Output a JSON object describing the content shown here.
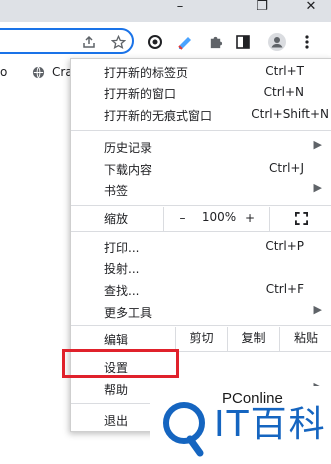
{
  "window": {
    "minimize_glyph": "–",
    "maximize_glyph": "❐",
    "close_glyph": "✕"
  },
  "toolbar": {
    "share_icon": "share-icon",
    "bookmark_icon": "star-icon",
    "extensions": [
      "extension-icon-1",
      "extension-icon-2"
    ],
    "puzzle_icon": "puzzle-icon",
    "sidepanel_icon": "side-panel-icon",
    "profile_icon": "profile-icon",
    "menu_icon": "more-vert-icon"
  },
  "bookmarks": {
    "items": [
      "o",
      "Cra"
    ]
  },
  "menu": {
    "new_tab": {
      "label": "打开新的标签页",
      "shortcut": "Ctrl+T"
    },
    "new_window": {
      "label": "打开新的窗口",
      "shortcut": "Ctrl+N"
    },
    "new_incognito": {
      "label": "打开新的无痕式窗口",
      "shortcut": "Ctrl+Shift+N"
    },
    "history": {
      "label": "历史记录"
    },
    "downloads": {
      "label": "下载内容",
      "shortcut": "Ctrl+J"
    },
    "bookmarks": {
      "label": "书签"
    },
    "zoom": {
      "label": "缩放",
      "minus": "–",
      "value": "100%",
      "plus": "+",
      "fullscreen": "⛶"
    },
    "print": {
      "label": "打印...",
      "shortcut": "Ctrl+P"
    },
    "cast": {
      "label": "投射..."
    },
    "find": {
      "label": "查找...",
      "shortcut": "Ctrl+F"
    },
    "more_tools": {
      "label": "更多工具"
    },
    "edit": {
      "label": "编辑",
      "cut": "剪切",
      "copy": "复制",
      "paste": "粘贴"
    },
    "settings": {
      "label": "设置"
    },
    "help": {
      "label": "帮助"
    },
    "exit": {
      "label": "退出"
    }
  },
  "watermark": {
    "brand": "PConline",
    "text": "IT百科"
  },
  "colors": {
    "accent": "#1a73e8",
    "highlight": "#e0212b",
    "watermark": "#1565c0"
  }
}
